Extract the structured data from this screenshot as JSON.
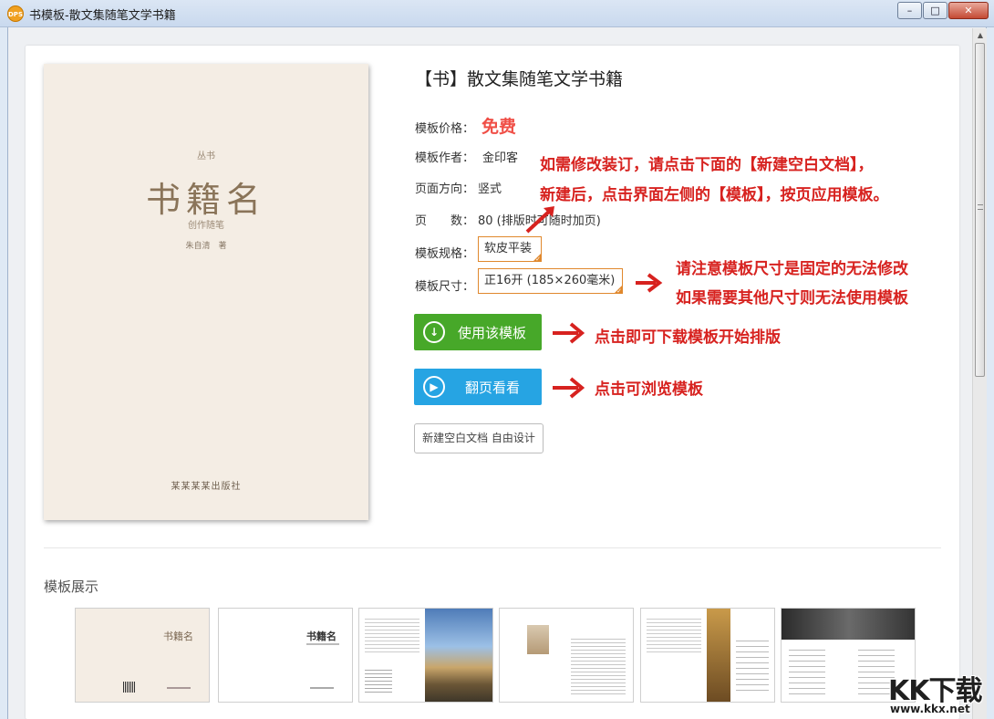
{
  "window": {
    "title": "书模板-散文集随笔文学书籍",
    "app_icon_text": "DPS",
    "minimize": "–",
    "maximize": "□",
    "close": "✕"
  },
  "cover": {
    "series": "丛书",
    "title": "书籍名",
    "subtitle": "创作随笔",
    "author": "朱自清　著",
    "publisher": "某某某某出版社"
  },
  "template": {
    "title": "【书】散文集随笔文学书籍",
    "price_label": "模板价格：",
    "price_value": "免费",
    "author_label": "模板作者：",
    "author_value": "金印客",
    "orientation_label": "页面方向：",
    "orientation_value": "竖式",
    "pages_label": "页　　数：",
    "pages_value": "80 (排版时可随时加页)",
    "spec_label": "模板规格：",
    "spec_value": "软皮平装",
    "size_label": "模板尺寸：",
    "size_value": "正16开 (185×260毫米)"
  },
  "buttons": {
    "use": "使用该模板",
    "flip": "翻页看看",
    "new_blank": "新建空白文档 自由设计"
  },
  "annotations": {
    "binding_line1": "如需修改装订，请点击下面的【新建空白文档】，",
    "binding_line2": "新建后，点击界面左侧的【模板】，按页应用模板。",
    "size_line1": "请注意模板尺寸是固定的无法修改",
    "size_line2": "如果需要其他尺寸则无法使用模板",
    "use_note": "点击即可下载模板开始排版",
    "flip_note": "点击可浏览模板"
  },
  "gallery": {
    "title": "模板展示",
    "thumb1_title": "书籍名",
    "thumb2_title": "书籍名"
  },
  "watermark": {
    "logo": "KK下载",
    "url": "www.kkx.net"
  },
  "colors": {
    "accent_red": "#d7221f",
    "price_red": "#f04f47",
    "green_button": "#47a829",
    "blue_button": "#26a4e3",
    "orange_border": "#e0882d"
  }
}
